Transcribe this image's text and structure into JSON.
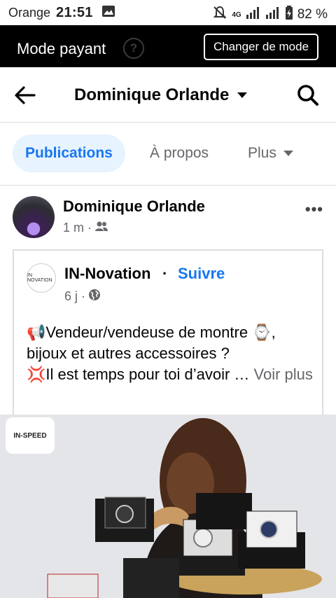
{
  "status_bar": {
    "carrier": "Orange",
    "time": "21:51",
    "network": "4G",
    "battery": "82 %"
  },
  "mode_bar": {
    "label": "Mode payant",
    "help_glyph": "?",
    "button_label": "Changer de mode"
  },
  "header": {
    "title": "Dominique Orlande"
  },
  "tabs": [
    {
      "label": "Publications",
      "active": true
    },
    {
      "label": "À propos",
      "active": false
    },
    {
      "label": "Plus",
      "active": false
    }
  ],
  "post": {
    "author": "Dominique Orlande",
    "time": "1 m ·",
    "more": "•••"
  },
  "shared_post": {
    "page_name": "IN-Novation",
    "separator": "·",
    "follow_label": "Suivre",
    "time": "6 j ·",
    "avatar_text": "IN NOVATION",
    "line1": "Vendeur/vendeuse de montre ",
    "line1_end": ",",
    "line2": "bijoux et autres accessoires ?",
    "line3": "Il est temps pour toi d’avoir … ",
    "see_more": "Voir plus",
    "emoji_megaphone": "📢",
    "emoji_watch": "⌚",
    "emoji_anger": "💢"
  },
  "photo": {
    "logo_text": "IN-SPEED"
  },
  "colors": {
    "accent": "#1877f2",
    "tab_active_bg": "#e7f3ff",
    "mode_bar_bg": "#000000"
  }
}
